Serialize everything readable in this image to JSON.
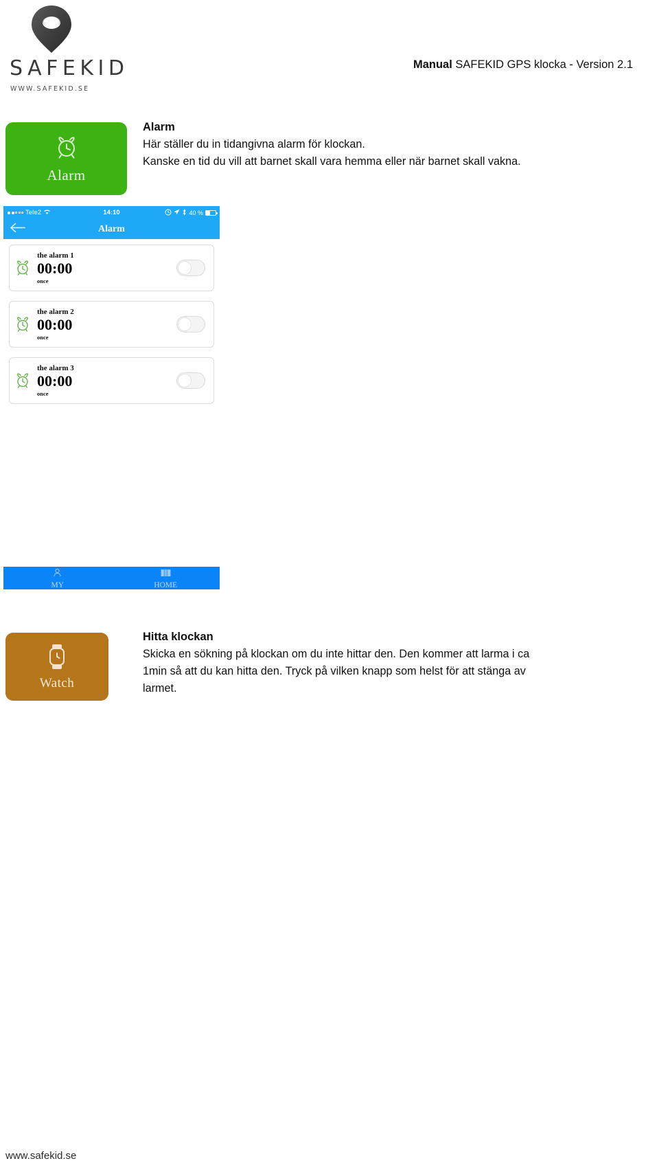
{
  "header": {
    "logo_wordmark": "SAFEKID",
    "logo_url": "WWW.SAFEKID.SE",
    "logo_icon": "map-pin-icon",
    "manual_bold": "Manual",
    "manual_rest": " SAFEKID GPS klocka - Version 2.1"
  },
  "alarm_section": {
    "tile": {
      "label": "Alarm",
      "icon": "alarm-clock-icon",
      "color": "#3cb313"
    },
    "heading": "Alarm",
    "line1": "Här ställer du in tidangivna alarm för klockan.",
    "line2": "Kanske en tid du vill att barnet skall vara hemma eller när barnet skall vakna."
  },
  "phone": {
    "statusbar": {
      "carrier": "Tele2",
      "time": "14:10",
      "battery_percent": "40 %",
      "icons": [
        "signal-dots-icon",
        "wifi-icon",
        "alarm-indicator-icon",
        "location-arrow-icon",
        "bluetooth-icon",
        "battery-icon"
      ]
    },
    "navbar": {
      "back_icon": "back-arrow-icon",
      "title": "Alarm"
    },
    "alarms": [
      {
        "name": "the alarm 1",
        "time": "00:00",
        "repeat": "once",
        "enabled": false,
        "icon": "alarm-clock-icon"
      },
      {
        "name": "the alarm 2",
        "time": "00:00",
        "repeat": "once",
        "enabled": false,
        "icon": "alarm-clock-icon"
      },
      {
        "name": "the alarm 3",
        "time": "00:00",
        "repeat": "once",
        "enabled": false,
        "icon": "alarm-clock-icon"
      }
    ],
    "tabbar": {
      "background": "#0a84f7",
      "tabs": [
        {
          "label": "MY",
          "icon": "person-icon"
        },
        {
          "label": "HOME",
          "icon": "map-icon"
        }
      ]
    }
  },
  "watch_section": {
    "tile": {
      "label": "Watch",
      "icon": "watch-icon",
      "color": "#b5751b"
    },
    "heading": "Hitta klockan",
    "line1": "Skicka en sökning på klockan om du inte hittar den. Den kommer att larma i ca",
    "line2": "1min så att du kan hitta den. Tryck på vilken knapp som helst för att stänga av",
    "line3": "larmet."
  },
  "footer": {
    "url": "www.safekid.se"
  }
}
